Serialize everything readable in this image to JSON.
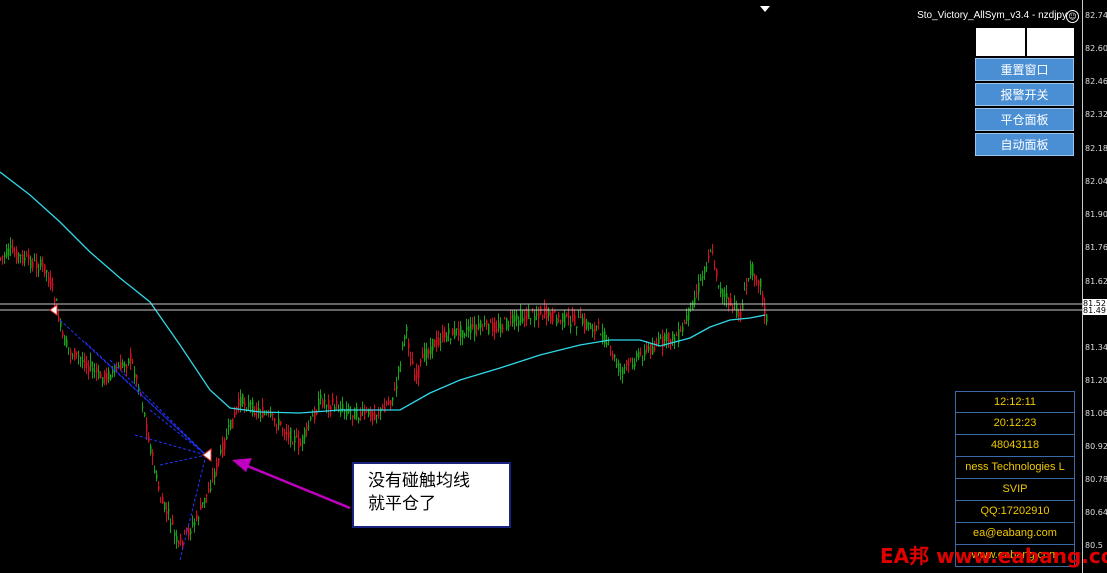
{
  "chart": {
    "title": "Sto_Victory_AllSym_v3.4 - nzdjpy",
    "price_ticks": [
      "82.74",
      "82.60",
      "82.46",
      "82.32",
      "82.18",
      "82.04",
      "81.90",
      "81.76",
      "81.62",
      "81.52",
      "81.49",
      "81.34",
      "81.20",
      "81.06",
      "80.92",
      "80.78",
      "80.64",
      "80.5"
    ],
    "current_price_label": "81.49",
    "line_price_label": "81.52"
  },
  "panel": {
    "buttons": [
      "重置窗口",
      "报警开关",
      "平仓面板",
      "自动面板"
    ]
  },
  "info": {
    "rows": [
      "12:12:11",
      "20:12:23",
      "48043118",
      "ness Technologies L",
      "SVIP",
      "QQ:17202910",
      "ea@eabang.com",
      "www.eabang.com"
    ]
  },
  "annotation": {
    "line1": "没有碰触均线",
    "line2": "就平仓了"
  },
  "watermark": "EA邦 www.eabang.com",
  "colors": {
    "bull": "#18a018",
    "bear": "#d01020",
    "ma": "#30d8e8",
    "fan": "#2233ff",
    "arrow": "#c000c0"
  }
}
